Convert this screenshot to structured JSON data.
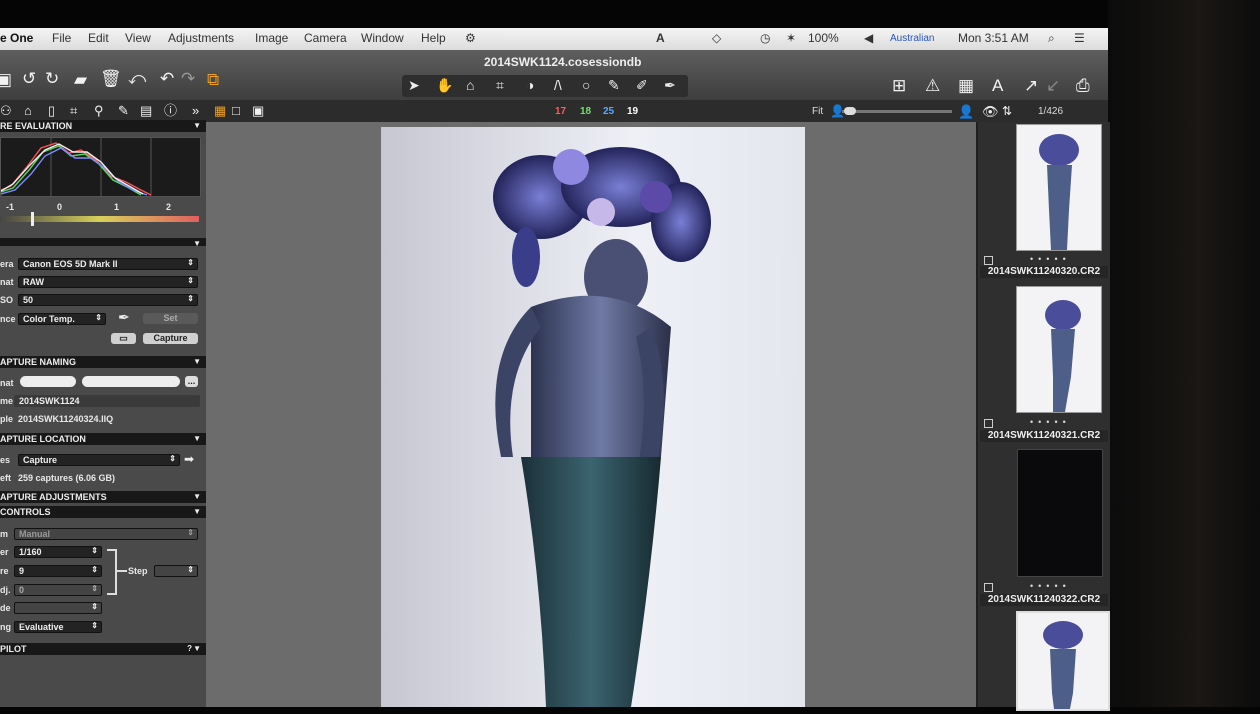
{
  "menubar": {
    "app": "e One",
    "items": [
      "File",
      "Edit",
      "View",
      "Adjustments",
      "Image",
      "Camera",
      "Window",
      "Help"
    ],
    "zoom": "100%",
    "input_source": "Australian",
    "clock": "Mon 3:51 AM"
  },
  "window": {
    "title": "2014SWK1124.cosessiondb"
  },
  "ratings": [
    "17",
    "18",
    "25",
    "19"
  ],
  "rating_colors": [
    "#ff5a5a",
    "#6ee36e",
    "#55aaff",
    "#ffffff"
  ],
  "viewer": {
    "fit_label": "Fit",
    "count": "1/426"
  },
  "left": {
    "exposure_section": "RE EVALUATION",
    "hist_ticks": [
      "-1",
      "0",
      "1",
      "2"
    ],
    "camera_rows": [
      {
        "label": "era",
        "value": "Canon EOS 5D Mark II"
      },
      {
        "label": "nat",
        "value": "RAW"
      },
      {
        "label": "SO",
        "value": "50"
      },
      {
        "label": "nce",
        "value": "Color Temp."
      }
    ],
    "set_label": "Set",
    "capture_label": "Capture",
    "naming_section": "APTURE NAMING",
    "naming_rows": [
      {
        "label": "nat",
        "value": ""
      },
      {
        "label": "me",
        "value": "2014SWK1124"
      },
      {
        "label": "ple",
        "value": "2014SWK11240324.IIQ"
      }
    ],
    "more_label": "...",
    "location_section": "APTURE LOCATION",
    "location_rows": [
      {
        "label": "es",
        "value": "Capture"
      },
      {
        "label": "eft",
        "value": "259 captures (6.06 GB)"
      }
    ],
    "adjustments_section": "APTURE ADJUSTMENTS",
    "controls_section": "CONTROLS",
    "control_rows": [
      {
        "label": "m",
        "value": "Manual"
      },
      {
        "label": "er",
        "value": "1/160"
      },
      {
        "label": "re",
        "value": "9"
      },
      {
        "label": "dj.",
        "value": "0"
      },
      {
        "label": "de",
        "value": ""
      },
      {
        "label": "ng",
        "value": "Evaluative"
      }
    ],
    "step_label": "Step",
    "pilot_section": "PILOT",
    "pilot_help": "?"
  },
  "browser": {
    "files": [
      "2014SWK11240320.CR2",
      "2014SWK11240321.CR2",
      "2014SWK11240322.CR2"
    ]
  }
}
